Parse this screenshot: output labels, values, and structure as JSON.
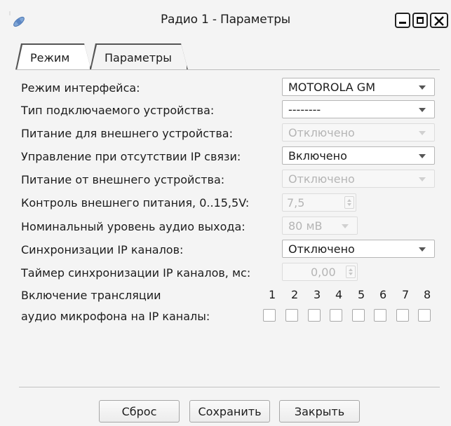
{
  "window": {
    "title": "Радио 1 - Параметры"
  },
  "tabs": {
    "mode": "Режим",
    "params": "Параметры"
  },
  "form": {
    "interface_mode": {
      "label": "Режим интерфейса:",
      "value": "MOTOROLA GM"
    },
    "device_type": {
      "label": "Тип подключаемого устройства:",
      "value": "--------"
    },
    "power_for_external": {
      "label": "Питание для внешнего устройства:",
      "value": "Отключено"
    },
    "control_no_ip": {
      "label": "Управление при отсутствии IP связи:",
      "value": "Включено"
    },
    "power_from_external": {
      "label": "Питание от внешнего устройства:",
      "value": "Отключено"
    },
    "external_power_control": {
      "label": "Контроль внешнего питания, 0..15,5V:",
      "value": "7,5"
    },
    "audio_out_level": {
      "label": "Номинальный уровень аудио выхода:",
      "value": "80 мВ"
    },
    "ip_sync": {
      "label": "Синхронизации IP каналов:",
      "value": "Отключено"
    },
    "ip_sync_timer": {
      "label": "Таймер синхронизации IP каналов, мс:",
      "value": "0,00"
    },
    "mic_broadcast": {
      "label_line1": "Включение трансляции",
      "label_line2": "аудио микрофона на IP каналы:",
      "channels": [
        "1",
        "2",
        "3",
        "4",
        "5",
        "6",
        "7",
        "8"
      ]
    }
  },
  "buttons": {
    "reset": "Сброс",
    "save": "Сохранить",
    "close": "Закрыть"
  }
}
